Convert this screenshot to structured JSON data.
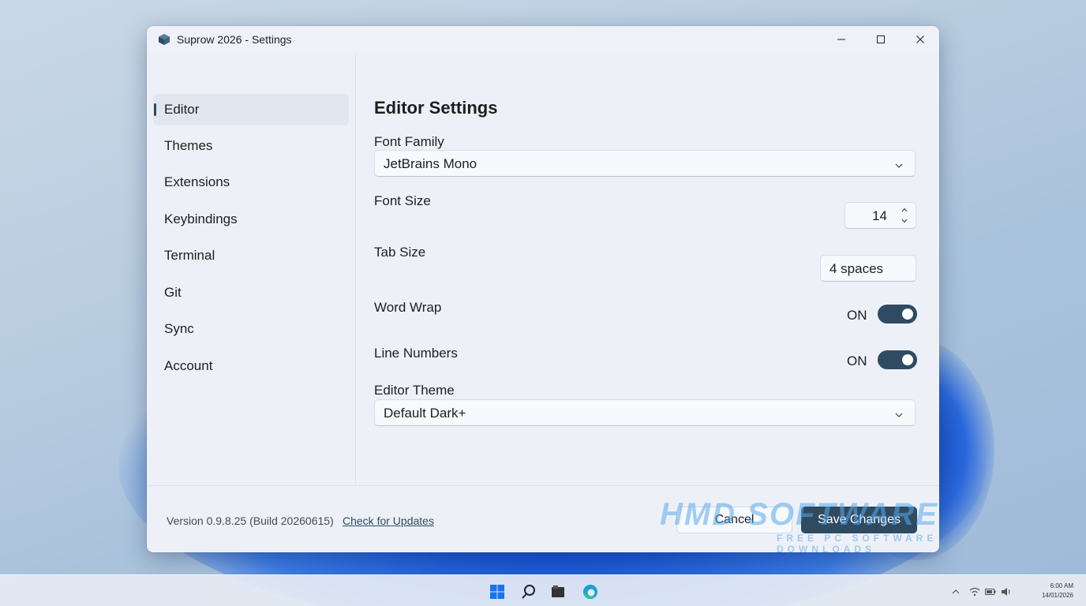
{
  "window": {
    "title": "Suprow 2026 - Settings"
  },
  "sidebar": {
    "items": [
      {
        "label": "Editor",
        "active": true
      },
      {
        "label": "Themes",
        "active": false
      },
      {
        "label": "Extensions",
        "active": false
      },
      {
        "label": "Keybindings",
        "active": false
      },
      {
        "label": "Terminal",
        "active": false
      },
      {
        "label": "Git",
        "active": false
      },
      {
        "label": "Sync",
        "active": false
      },
      {
        "label": "Account",
        "active": false
      }
    ]
  },
  "main": {
    "title": "Editor Settings",
    "font_family": {
      "label": "Font Family",
      "value": "JetBrains Mono"
    },
    "font_size": {
      "label": "Font Size",
      "value": "14"
    },
    "tab_size": {
      "label": "Tab Size",
      "value": "4 spaces"
    },
    "word_wrap": {
      "label": "Word Wrap",
      "state": "ON"
    },
    "line_numbers": {
      "label": "Line Numbers",
      "state": "ON"
    },
    "editor_theme": {
      "label": "Editor Theme",
      "value": "Default Dark+"
    }
  },
  "footer": {
    "version": "Version 0.9.8.25 (Build 20260615)",
    "check_updates": "Check for Updates",
    "cancel": "Cancel",
    "save": "Save Changes"
  },
  "watermark": {
    "main": "HMD SOFTWARE",
    "sub": "FREE PC SOFTWARE DOWNLOADS"
  },
  "taskbar": {
    "icons": [
      "windows-start-icon",
      "search-icon",
      "file-explorer-icon",
      "edge-browser-icon"
    ],
    "tray_icons": [
      "chevron-up-icon",
      "wifi-icon",
      "battery-icon",
      "volume-icon"
    ],
    "clock_time": "6:00 AM",
    "clock_date": "14/01/2026"
  },
  "colors": {
    "accent": "#2f4b62",
    "window_bg": "#edf1f7",
    "active_nav_bg": "#e2e7ef"
  }
}
